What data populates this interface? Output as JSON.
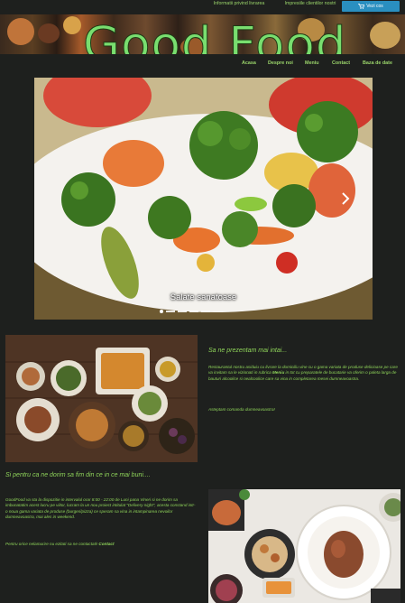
{
  "header": {
    "link_delivery": "Informatii privind livrarea",
    "link_reviews": "Impresiile clientilor nostri",
    "cart_label": "Vezi cos",
    "logo_text": "Good Food"
  },
  "nav": {
    "items": [
      "Acasa",
      "Despre noi",
      "Meniu",
      "Contact",
      "Baza de date"
    ]
  },
  "carousel": {
    "caption": "Salate sanatoase",
    "slide_count": 5,
    "active_index": 0
  },
  "about": {
    "title": "Sa ne prezentam mai intai...",
    "paragraph1_a": "Restaurantul nostru asiduiu cu livrare la domiciliu vine cu o gama variata de produse delicioase pe care va invitam sa le vizionati in rubrica ",
    "paragraph1_link": "Meniu",
    "paragraph1_b": " in tot cu preparatele de bucatarie va oferim o paleta larga de bauturi alcoolice si nealcoolice care sa vina in completarea mesei dumneavoastra.",
    "paragraph2": "Asteptam comanda dumneavoastra!"
  },
  "mission": {
    "title": "Si pentru ca ne dorim sa fim din ce in ce mai buni....",
    "paragraph1": "GoodFood va sta la dispozitie in intervalul orar 8:00 - 22:00 de Luni pana Vineri si ne dorim sa imbunatatim acest lucru pe viitor, lucram la un nou proiect intitulat \"Delivery night\", acesta constand intr-o noua gama variata de produse (burgeri/pizza) ce speram sa vina in intampinarea nevoilor dumneavoastra, mai ales in weekend.",
    "paragraph2_a": "Pentru orice nelamurire nu ezitati sa ne contactati! ",
    "paragraph2_link": "Contact"
  },
  "colors": {
    "background": "#1e201e",
    "text": "#8fd45a",
    "logo": "#79de6f",
    "cart_button": "#2a8fc0"
  },
  "icons": [
    "cart-icon",
    "chevron-right-icon"
  ]
}
